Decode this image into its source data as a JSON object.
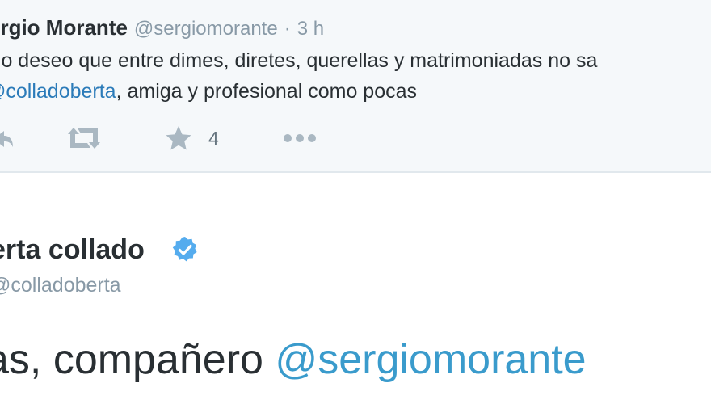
{
  "reply_tweet": {
    "fullname": "ergio Morante",
    "username": "@sergiomorante",
    "separator": "·",
    "time": "3 h",
    "text_line1": "olo deseo que entre dimes, diretes, querellas y matrimoniadas no sa",
    "text_line2_mention": "@colladoberta",
    "text_line2_rest": ", amiga y profesional como pocas",
    "actions": {
      "reply_icon": "reply-icon",
      "retweet_icon": "retweet-icon",
      "favorite_icon": "star-icon",
      "favorite_count": "4",
      "more_icon": "more-dots-icon"
    }
  },
  "main_tweet": {
    "fullname": "erta collado",
    "verified_icon": "verified-badge-icon",
    "username": "@colladoberta",
    "text_prefix": "as, compañero ",
    "text_mention": "@sergiomorante"
  },
  "colors": {
    "reply_background": "#f5f8fa",
    "divider": "#e1e8ed",
    "mention_link": "#2b7bb9",
    "verified_badge": "#55acee",
    "icon_gray": "#aab8c2",
    "secondary_text": "#8899a6"
  }
}
